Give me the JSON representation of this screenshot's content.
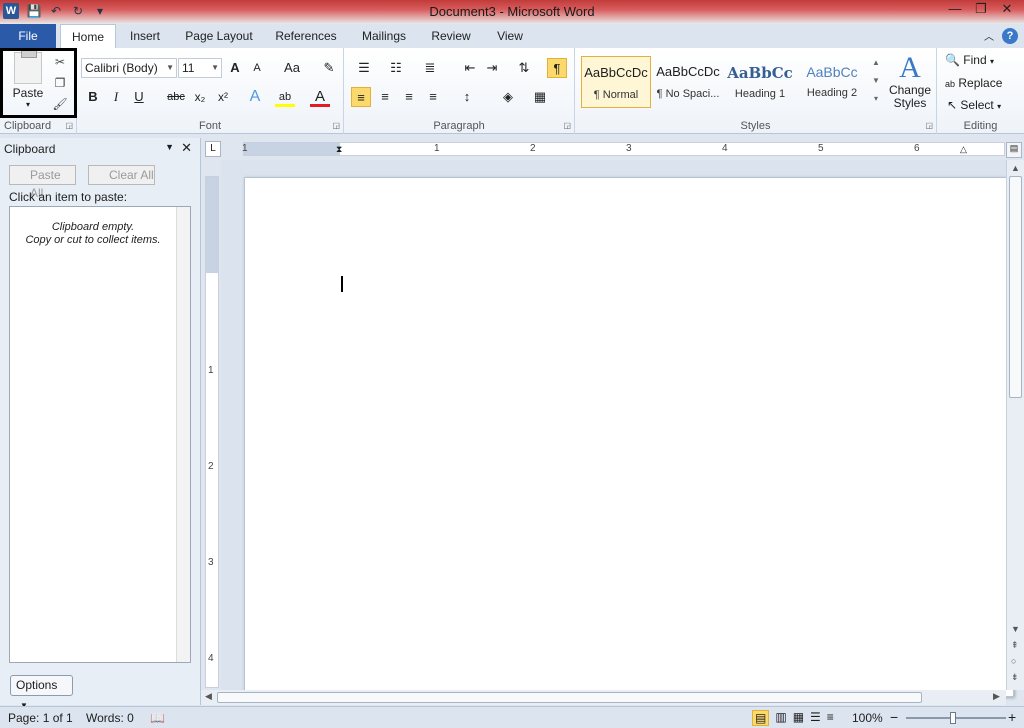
{
  "window": {
    "title": "Document3 - Microsoft Word",
    "app_icon_letter": "W",
    "controls": {
      "minimize": "—",
      "maximize": "❐",
      "close": "✕"
    }
  },
  "quick_access": {
    "save_icon": "💾",
    "undo_icon": "↶",
    "redo_icon": "↻",
    "customize_icon": "▾"
  },
  "tabs": {
    "file": "File",
    "items": [
      "Home",
      "Insert",
      "Page Layout",
      "References",
      "Mailings",
      "Review",
      "View"
    ],
    "active": "Home"
  },
  "ribbon": {
    "clipboard": {
      "label": "Clipboard",
      "paste": "Paste"
    },
    "font": {
      "label": "Font",
      "family": "Calibri (Body)",
      "size": "11",
      "grow": "A",
      "shrink": "A",
      "case": "Aa",
      "bold": "B",
      "italic": "I",
      "underline": "U",
      "strike": "abc",
      "subscript": "x₂",
      "superscript": "x²",
      "text_effects": "A",
      "highlight": "ab",
      "font_color": "A",
      "font_color_value": "#e02020",
      "highlight_color_value": "#ffff00"
    },
    "paragraph": {
      "label": "Paragraph",
      "show_marks": "¶"
    },
    "styles": {
      "label": "Styles",
      "items": [
        {
          "sample": "AaBbCcDc",
          "name": "¶ Normal"
        },
        {
          "sample": "AaBbCcDc",
          "name": "¶ No Spaci..."
        },
        {
          "sample": "AaBbCc",
          "name": "Heading 1"
        },
        {
          "sample": "AaBbCc",
          "name": "Heading 2"
        }
      ],
      "change_styles": "Change Styles"
    },
    "editing": {
      "label": "Editing",
      "find": "Find",
      "replace": "Replace",
      "select": "Select"
    }
  },
  "clipboard_pane": {
    "title": "Clipboard",
    "paste_all": "Paste All",
    "clear_all": "Clear All",
    "instruction": "Click an item to paste:",
    "empty_line1": "Clipboard empty.",
    "empty_line2": "Copy or cut to collect items.",
    "options": "Options"
  },
  "ruler": {
    "h_numbers": [
      "1",
      "1",
      "2",
      "3",
      "4",
      "5",
      "6"
    ],
    "v_numbers": [
      "1",
      "2",
      "3",
      "4"
    ]
  },
  "status_bar": {
    "page": "Page: 1 of 1",
    "words": "Words: 0",
    "zoom": "100%",
    "zoom_out": "−",
    "zoom_in": "+"
  }
}
